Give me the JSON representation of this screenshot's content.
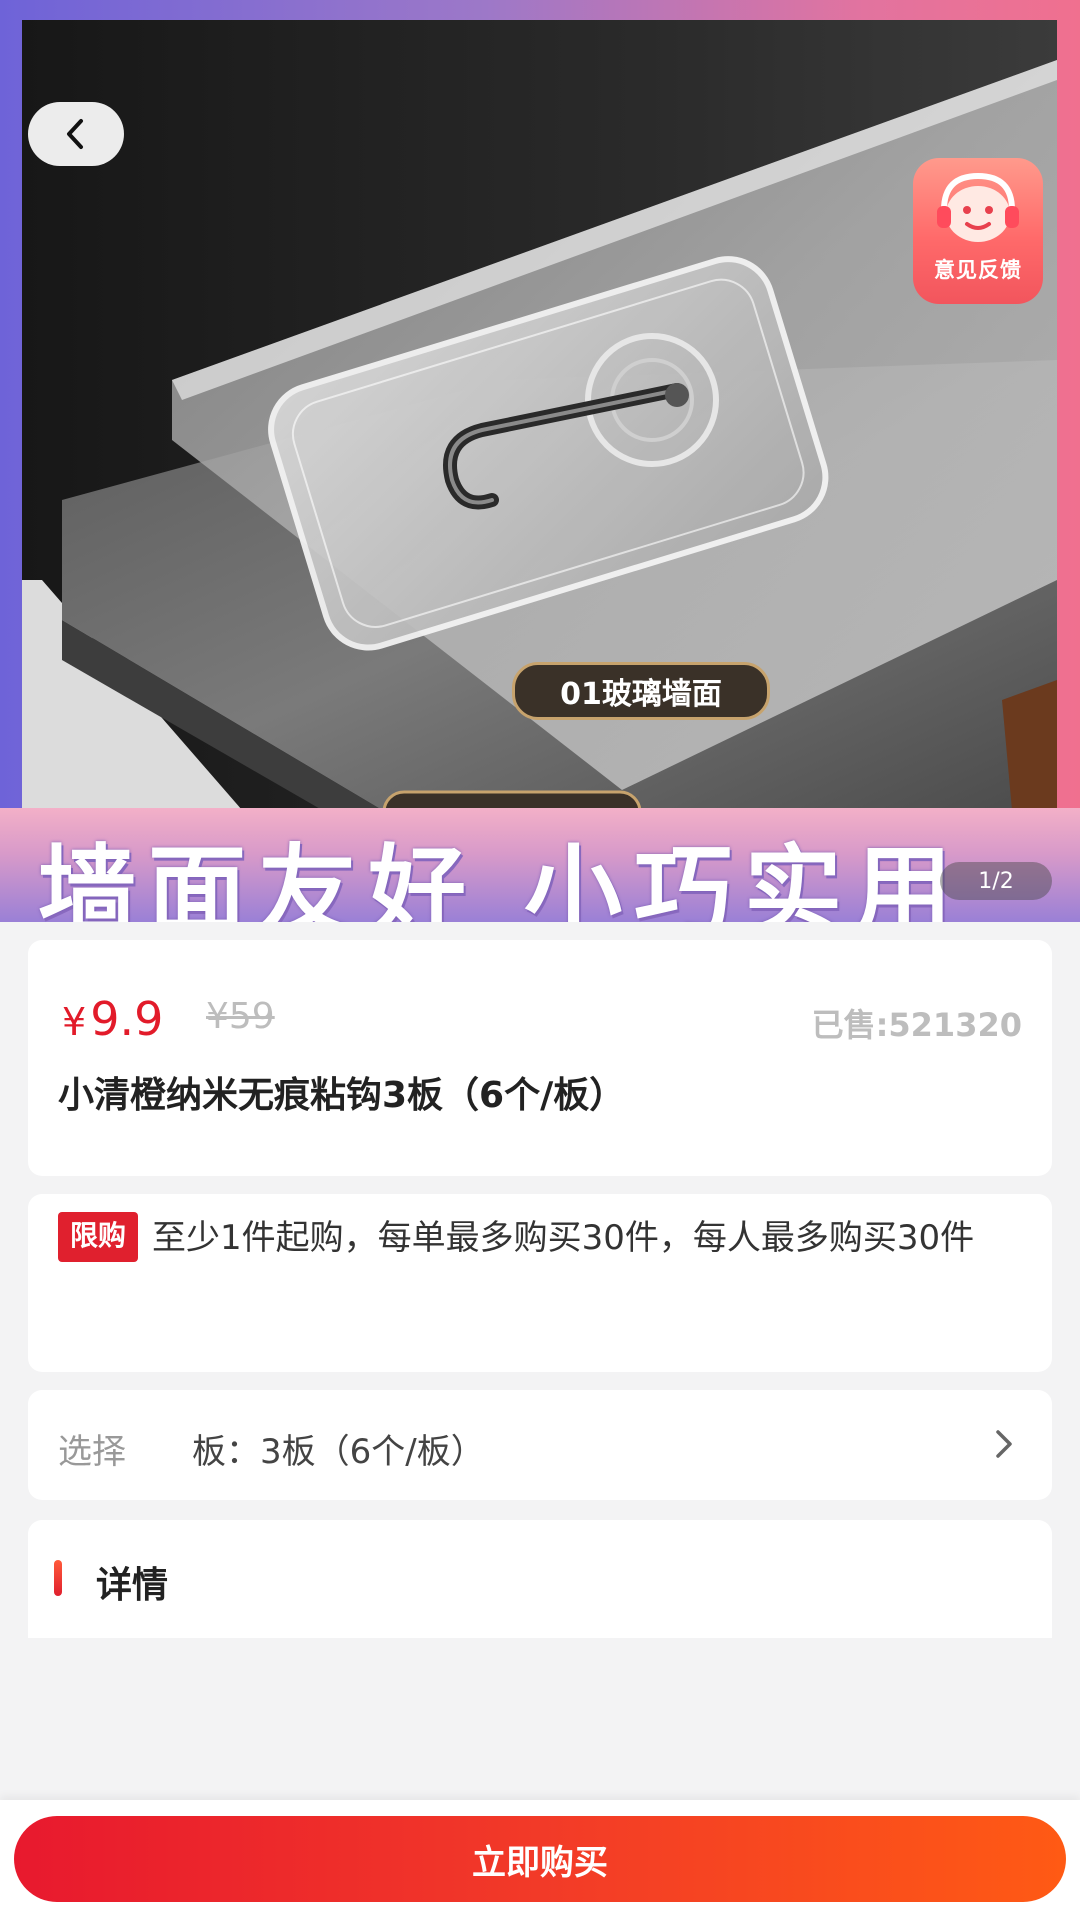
{
  "hero": {
    "image_alt": "透明无痕粘钩产品图",
    "surface_label": "01玻璃墙面",
    "banner_text": "墙面友好 小巧实用",
    "pager": "1/2",
    "feedback_label": "意见反馈"
  },
  "product": {
    "currency": "¥",
    "price": "9.9",
    "original_price": "¥59",
    "sold": "已售:521320",
    "title": "小清橙纳米无痕粘钩3板（6个/板）"
  },
  "limit": {
    "badge": "限购",
    "text": "至少1件起购，每单最多购买30件，每人最多购买30件"
  },
  "select": {
    "label": "选择",
    "value": "板：3板（6个/板）"
  },
  "detail": {
    "title": "详情"
  },
  "footer": {
    "buy_label": "立即购买"
  },
  "colors": {
    "accent": "#e21b2a",
    "button_start": "#e8192e",
    "button_end": "#ff5a14"
  }
}
